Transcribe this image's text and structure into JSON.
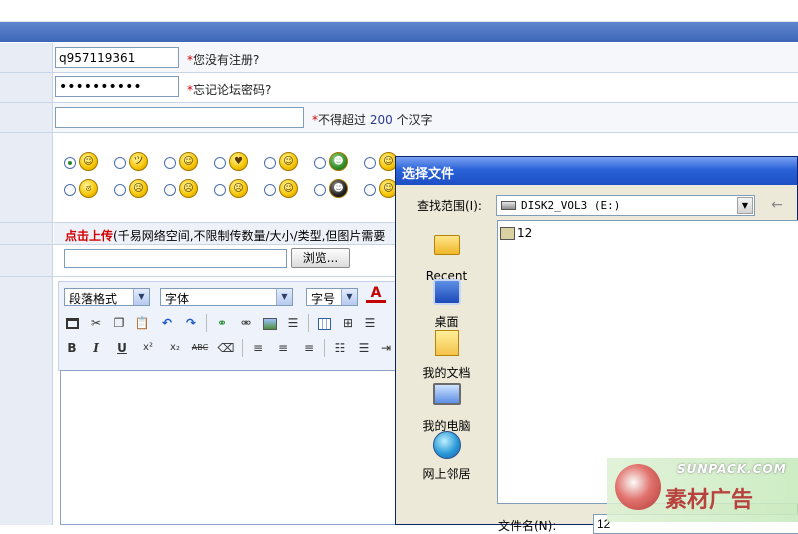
{
  "form": {
    "username_value": "q957119361",
    "username_hint_star": "*",
    "username_hint": "您没有注册?",
    "password_value": "••••••••••",
    "password_hint_star": "*",
    "password_hint": "忘记论坛密码?",
    "title_value": "",
    "title_hint_star": "*",
    "title_hint_pre": "不得超过 ",
    "title_hint_num": "200",
    "title_hint_post": " 个汉字",
    "upload_link": "点击上传",
    "upload_note": "(千易网络空间,不限制传数量/大小/类型,但图片需要",
    "browse_label": "浏览..."
  },
  "smileys": {
    "row1": [
      "smile",
      "grin-blush",
      "happy",
      "love-eyes",
      "tongue",
      "turtle",
      "smile-2"
    ],
    "row2": [
      "angry",
      "grimace",
      "cry",
      "sweat",
      "wink",
      "dark-face",
      "smile-3"
    ],
    "row1_glyphs": [
      "☺",
      "ツ",
      "☺",
      "♥",
      "☺",
      "☻",
      "☺"
    ],
    "row2_glyphs": [
      "ಠ",
      "☹",
      "☹",
      "☹",
      "☺",
      "☻",
      "☺"
    ],
    "selected": 0
  },
  "editor": {
    "paragraph_format": "段落格式",
    "font_face": "字体",
    "font_size": "字号",
    "font_color_glyph": "A",
    "bold": "B",
    "italic": "I",
    "underline": "U",
    "superscript": "x²",
    "subscript": "x₂",
    "strikethrough": "ABC"
  },
  "dialog": {
    "title": "选择文件",
    "lookin_label": "查找范围(I):",
    "lookin_value": "DISK2_VOL3 (E:)",
    "places": [
      "Recent",
      "桌面",
      "我的文档",
      "我的电脑",
      "网上邻居"
    ],
    "files": [
      "12"
    ],
    "filename_label": "文件名(N):",
    "filename_value": "12"
  },
  "watermark": {
    "url": "SUNPACK.COM",
    "cn": "素材广告"
  }
}
